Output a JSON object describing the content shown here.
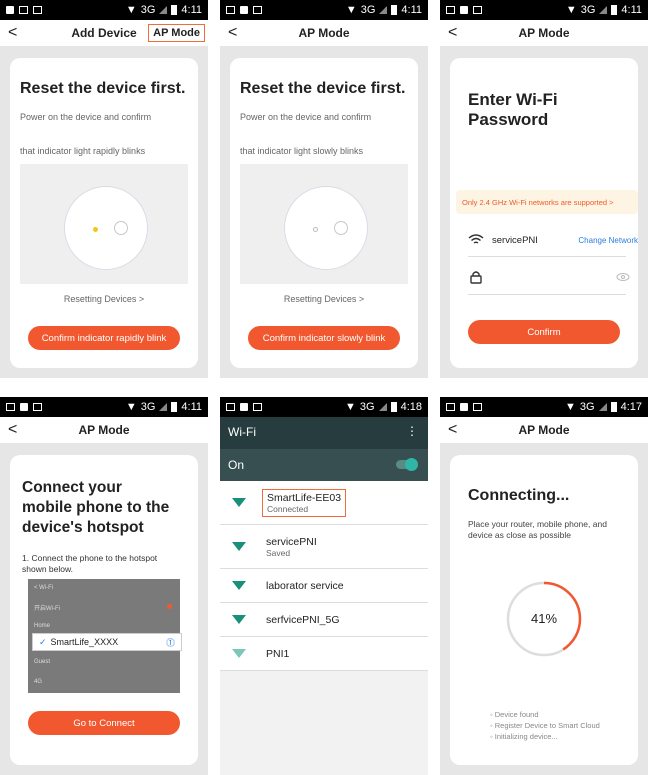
{
  "status_bars": [
    {
      "signal": "3G",
      "time": "4:11"
    },
    {
      "signal": "3G",
      "time": "4:11"
    },
    {
      "signal": "3G",
      "time": "4:11"
    },
    {
      "signal": "3G",
      "time": "4:11"
    },
    {
      "signal": "3G",
      "time": "4:18"
    },
    {
      "signal": "3G",
      "time": "4:17"
    }
  ],
  "panel1": {
    "back": "<",
    "title": "Add Device",
    "ap_mode": "AP Mode",
    "heading": "Reset the device first.",
    "line1": "Power on the device and confirm",
    "line2": "that indicator light rapidly blinks",
    "resetting": "Resetting Devices >",
    "button": "Confirm indicator rapidly blink"
  },
  "panel2": {
    "back": "<",
    "title": "AP Mode",
    "heading": "Reset the device first.",
    "line1": "Power on the device and confirm",
    "line2": "that indicator light slowly blinks",
    "resetting": "Resetting Devices >",
    "button": "Confirm indicator slowly blink"
  },
  "panel3": {
    "back": "<",
    "title": "AP Mode",
    "heading_line1": "Enter Wi-Fi",
    "heading_line2": "Password",
    "warning": "Only 2.4 GHz Wi-Fi networks are supported >",
    "network": "servicePNI",
    "change_network": "Change Network",
    "button": "Confirm"
  },
  "panel4": {
    "back": "<",
    "title": "AP Mode",
    "heading_line1": "Connect your",
    "heading_line2": "mobile phone to the",
    "heading_line3": "device's hotspot",
    "step_line1": "1. Connect the phone to the hotspot",
    "step_line2": "shown below.",
    "mini_wifi": "< Wi-Fi",
    "mini_row2": "开启Wi-Fi",
    "mini_row3": "Home",
    "mini_row4": "Guest",
    "mini_row5": "4G",
    "hotspot": "SmartLife_XXXX",
    "button": "Go to Connect"
  },
  "panel5": {
    "title": "Wi-Fi",
    "menu": "⋮",
    "toggle_label": "On",
    "networks": [
      {
        "name": "SmartLife-EE03",
        "sub": "Connected"
      },
      {
        "name": "servicePNI",
        "sub": "Saved"
      },
      {
        "name": "laborator service",
        "sub": ""
      },
      {
        "name": "serfvicePNI_5G",
        "sub": ""
      },
      {
        "name": "PNI1",
        "sub": ""
      }
    ]
  },
  "panel6": {
    "back": "<",
    "title": "AP Mode",
    "heading": "Connecting...",
    "desc_line1": "Place your router, mobile phone, and",
    "desc_line2": "device as close as possible",
    "progress": 41,
    "progress_label": "41%",
    "steps": [
      "Device found",
      "Register Device to Smart Cloud",
      "Initializing device..."
    ]
  },
  "colors": {
    "accent": "#f2582f",
    "wifi_bar": "#2b3d3e",
    "wifi_icon": "#1a8f7a",
    "link": "#2a7de1",
    "highlight": "#f26b3a"
  }
}
